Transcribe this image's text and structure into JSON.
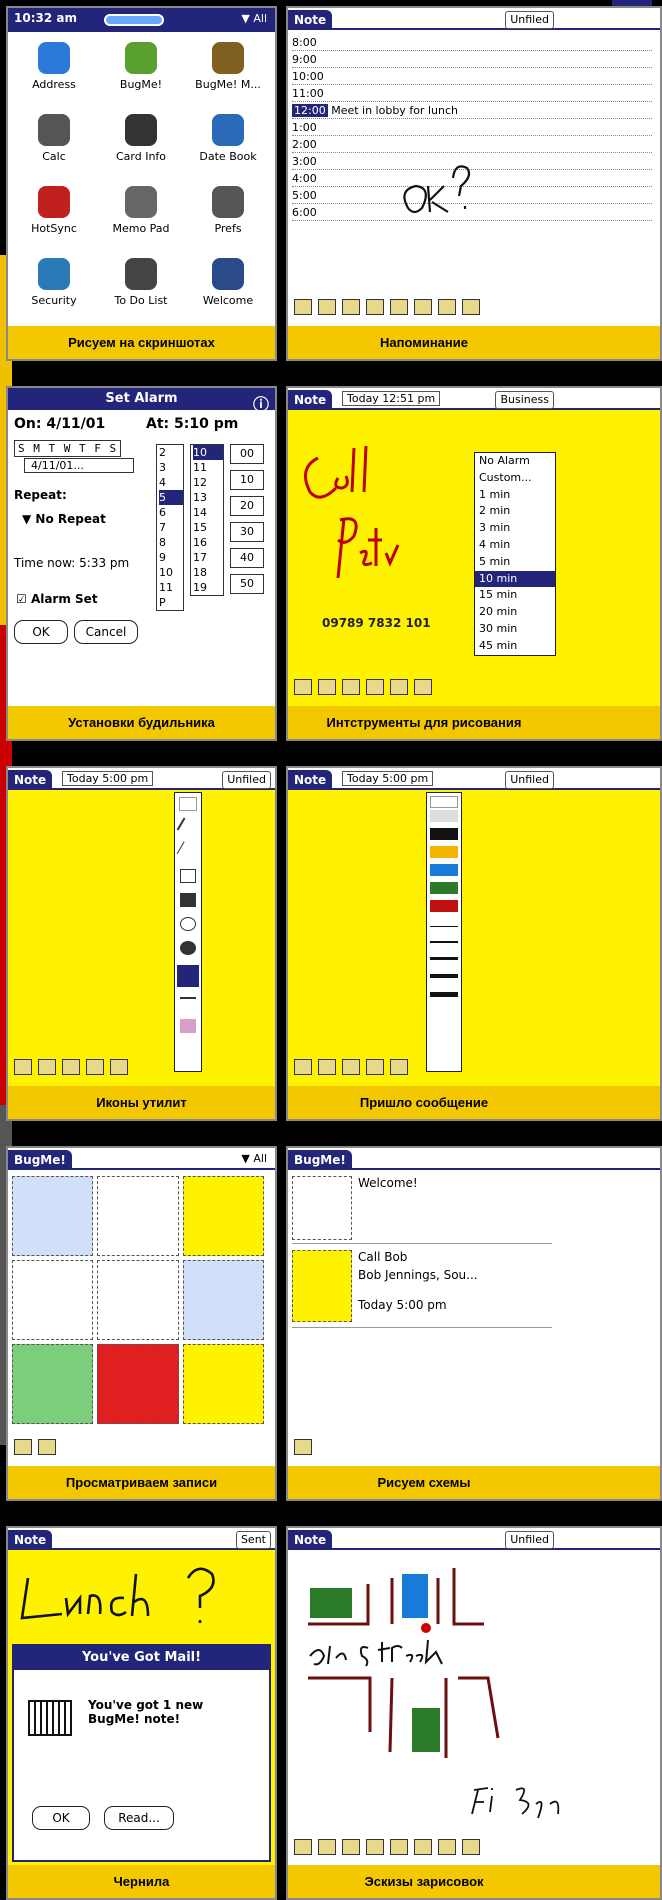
{
  "captions": [
    "Рисуем на скриншотах",
    "Напоминание",
    "Установки будильника",
    "Интструменты для рисования",
    "Иконы утилит",
    "Пришло сообщение",
    "Просматриваем записи",
    "Рисуем схемы",
    "Чернила",
    "Эскизы зарисовок"
  ],
  "launcher": {
    "time": "10:32 am",
    "apps": [
      "Address",
      "BugMe!",
      "BugMe! M...",
      "Calc",
      "Card Info",
      "Date Book",
      "HotSync",
      "Memo Pad",
      "Prefs",
      "Security",
      "To Do List",
      "Welcome"
    ]
  },
  "note_reminder": {
    "tab": "Note",
    "category": "Unfiled",
    "times": [
      "8:00",
      "9:00",
      "10:00",
      "11:00",
      "12:00",
      "1:00",
      "2:00",
      "3:00",
      "4:00",
      "5:00",
      "6:00"
    ],
    "event": "Meet in lobby for lunch",
    "ink": "ok?"
  },
  "alarm": {
    "title": "Set Alarm",
    "on_label": "On: 4/11/01",
    "at_label": "At: 5:10 pm",
    "days": "S M T W T F S",
    "date": "4/11/01...",
    "repeat_label": "Repeat:",
    "repeat_value": "▼ No Repeat",
    "time_now": "Time now: 5:33 pm",
    "alarm_set": "Alarm Set",
    "ok": "OK",
    "cancel": "Cancel",
    "hours": [
      "2",
      "3",
      "4",
      "5",
      "6",
      "7",
      "8",
      "9",
      "10",
      "11 P"
    ],
    "mins_a": [
      "10",
      "11",
      "12",
      "13",
      "14",
      "15",
      "16",
      "17",
      "18",
      "19"
    ],
    "mins_b": [
      "00",
      "10",
      "20",
      "30",
      "40",
      "50"
    ]
  },
  "drawing_tools": {
    "tab": "Note",
    "date": "Today 12:51 pm",
    "category": "Business",
    "ink1": "Call",
    "ink2": "Peter",
    "phone": "09789 7832 101",
    "menu": [
      "No Alarm",
      "Custom...",
      "1 min",
      "2 min",
      "3 min",
      "4 min",
      "5 min",
      "10 min",
      "15 min",
      "20 min",
      "30 min",
      "45 min"
    ],
    "selected": "10 min"
  },
  "util_icons": {
    "tab": "Note",
    "date": "Today 5:00 pm",
    "category": "Unfiled"
  },
  "message_arrived": {
    "tab": "Note",
    "date": "Today 5:00 pm",
    "category": "Unfiled"
  },
  "browse": {
    "title": "BugMe!"
  },
  "schemes": {
    "title": "BugMe!",
    "item1": "Welcome!",
    "item2": "Call Bob",
    "item2_sub": "Bob Jennings, Sou...",
    "item2_time": "Today 5:00 pm"
  },
  "ink": {
    "tab": "Note",
    "category": "Sent",
    "ink": "Lunch?",
    "dialog_title": "You've Got Mail!",
    "dialog_text": "You've got 1 new BugMe! note!",
    "ok": "OK",
    "read": "Read..."
  },
  "sketch": {
    "tab": "Note",
    "category": "Unfiled",
    "ink1": "3rd Street",
    "ink2": "Fri 3pm"
  },
  "colors": {
    "caption_bg": "#f4c800",
    "title_blue": "#23257a",
    "note_yellow": "#fff200"
  }
}
